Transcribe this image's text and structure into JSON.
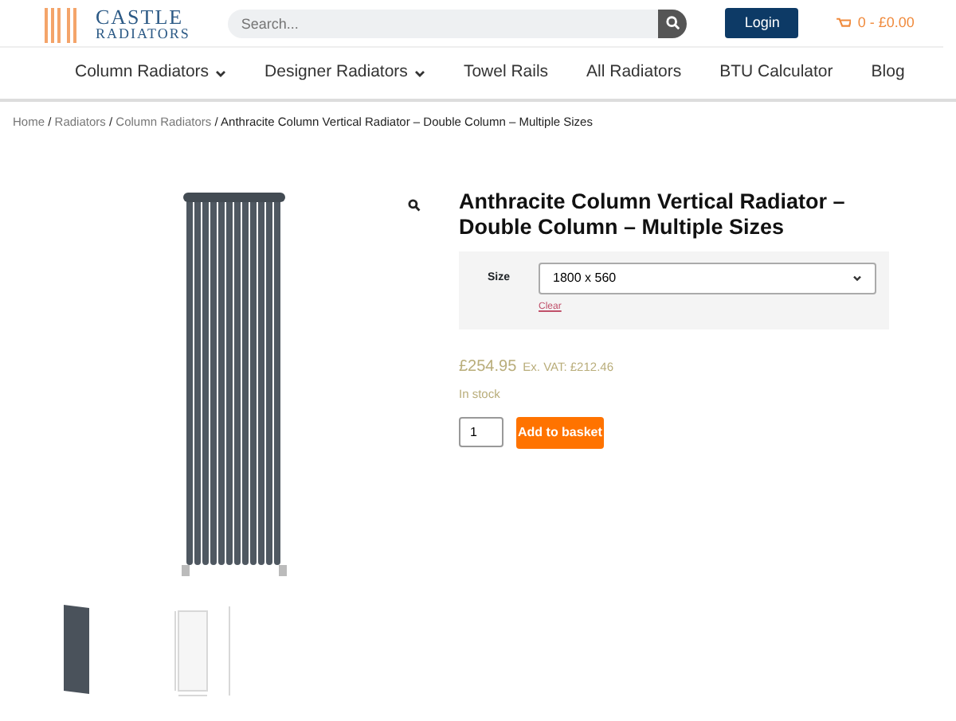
{
  "header": {
    "logo": [
      "CASTLE",
      "RADIATORS"
    ],
    "search": {
      "placeholder": "Search..."
    },
    "login": "Login",
    "cart": "0 - £0.00"
  },
  "nav": [
    {
      "label": "Column Radiators",
      "dropdown": true
    },
    {
      "label": "Designer Radiators",
      "dropdown": true
    },
    {
      "label": "Towel Rails",
      "dropdown": false
    },
    {
      "label": "All Radiators",
      "dropdown": false
    },
    {
      "label": "BTU Calculator",
      "dropdown": false
    },
    {
      "label": "Blog",
      "dropdown": false
    }
  ],
  "breadcrumb_separator": "/",
  "breadcrumb": [
    "Home",
    "Radiators",
    "Column Radiators",
    "Anthracite Column Vertical Radiator – Double Column – Multiple Sizes"
  ],
  "product": {
    "title": "Anthracite Column Vertical Radiator – Double Column – Multiple Sizes",
    "size_label": "Size",
    "size_value": "1800 x 560",
    "clear": "Clear",
    "price": "£254.95",
    "ex_vat": "Ex. VAT: £212.46",
    "stock": "In stock",
    "quantity": "1",
    "add_button": "Add to basket"
  },
  "thumbnails": [
    {
      "kind": "photo",
      "selected": true
    },
    {
      "kind": "diagram",
      "selected": false
    }
  ]
}
